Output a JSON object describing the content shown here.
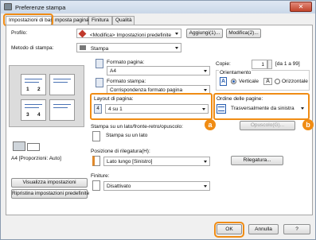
{
  "window": {
    "title": "Preferenze stampa",
    "close_label": "✕"
  },
  "tabs": [
    {
      "label": "Impostazioni di base"
    },
    {
      "label": "mposta pagina"
    },
    {
      "label": "Finitura"
    },
    {
      "label": "Qualità"
    }
  ],
  "profile": {
    "label": "Profilo:",
    "value": "<Modifica> Impostazioni predefinite",
    "add_button": "Aggiungi(1)...",
    "edit_button": "Modifica(2)..."
  },
  "print_method": {
    "label": "Metodo di stampa:",
    "value": "Stampa"
  },
  "page_size": {
    "label": "Formato pagina:",
    "value": "A4"
  },
  "output_size": {
    "label": "Formato stampa:",
    "value": "Corrispondenza formato pagina"
  },
  "copies": {
    "label": "Copie:",
    "value": "1",
    "range": "[da 1 a 99]"
  },
  "orientation": {
    "label": "Orientamento",
    "options": [
      {
        "letter": "A",
        "label": "Verticale",
        "selected": true
      },
      {
        "letter": "A",
        "label": "Orizzontale",
        "selected": false
      }
    ]
  },
  "layout": {
    "label": "Layout di pagina:",
    "value": "4 su 1"
  },
  "page_order": {
    "label": "Ordine delle pagine:",
    "value": "Trasversalmente da sinistra"
  },
  "options_button": "Opuscolo(G)...",
  "preview": {
    "page_numbers": [
      "1",
      "2",
      "3",
      "4"
    ],
    "caption": "A4 [Proporzioni: Auto]"
  },
  "duplex": {
    "label": "Stampa su un lato/fronte-retro/opuscolo:",
    "value": "Stampa su un lato"
  },
  "binding": {
    "label": "Posizione di rilegatura(H):",
    "value": "Lato lungo [Sinistro]",
    "button": "Rilegatura..."
  },
  "finishing": {
    "label": "Finiture:",
    "value": "Disattivato"
  },
  "view_settings_button": "Visualizza impostazioni",
  "restore_defaults_button": "Ripristina impostazioni predefinite",
  "callouts": {
    "a": "a",
    "b": "b"
  },
  "footer": {
    "ok": "OK",
    "cancel": "Annulla",
    "help": "?"
  },
  "colors": {
    "highlight": "#f08c14",
    "accent": "#2a5fb0"
  }
}
